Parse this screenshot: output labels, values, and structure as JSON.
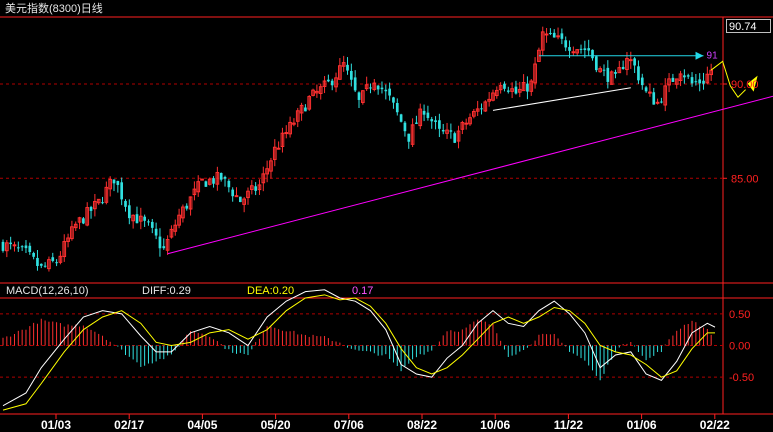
{
  "title": "美元指数(8300)日线",
  "last_price": "90.74",
  "indicator": {
    "name": "MACD(12,26,10)",
    "diff": "DIFF:0.29",
    "dea": "DEA:0.20",
    "macd": "0.17"
  },
  "colors": {
    "up": "#ff3030",
    "down": "#30e0e0",
    "trendline": "#ff00ff",
    "dea": "#ffff00",
    "diff": "#ffffff",
    "grid": "#b00000",
    "axis": "#ff2020"
  },
  "chart_data": [
    {
      "type": "candlestick",
      "title": "美元指数(8300)日线",
      "x_tick_labels": [
        "01/03",
        "02/17",
        "04/05",
        "05/20",
        "07/06",
        "08/22",
        "10/06",
        "11/22",
        "01/06",
        "02/22"
      ],
      "y_tick_labels": [
        "90.00",
        "85.00"
      ],
      "y_range": [
        79.5,
        93.5
      ],
      "grid": "dashed horizontal",
      "close_path": [
        [
          0,
          81.5
        ],
        [
          6,
          81.0
        ],
        [
          10,
          80.2
        ],
        [
          14,
          80.6
        ],
        [
          19,
          82.5
        ],
        [
          25,
          83.7
        ],
        [
          29,
          85.0
        ],
        [
          33,
          83.2
        ],
        [
          38,
          82.4
        ],
        [
          42,
          81.2
        ],
        [
          46,
          83.0
        ],
        [
          52,
          84.8
        ],
        [
          57,
          85.0
        ],
        [
          62,
          83.8
        ],
        [
          67,
          84.6
        ],
        [
          71,
          86.5
        ],
        [
          76,
          88.0
        ],
        [
          80,
          89.2
        ],
        [
          85,
          90.0
        ],
        [
          89,
          91.0
        ],
        [
          93,
          89.0
        ],
        [
          97,
          90.3
        ],
        [
          101,
          89.2
        ],
        [
          104,
          88.0
        ],
        [
          106,
          87.2
        ],
        [
          110,
          88.7
        ],
        [
          114,
          87.4
        ],
        [
          118,
          87.2
        ],
        [
          122,
          88.2
        ],
        [
          126,
          89.0
        ],
        [
          130,
          90.2
        ],
        [
          134,
          89.5
        ],
        [
          138,
          90.0
        ],
        [
          141,
          92.6
        ],
        [
          145,
          92.3
        ],
        [
          149,
          92.0
        ],
        [
          153,
          91.8
        ],
        [
          156,
          90.7
        ],
        [
          160,
          90.2
        ],
        [
          163,
          91.5
        ],
        [
          165,
          90.9
        ],
        [
          168,
          89.5
        ],
        [
          171,
          89.0
        ],
        [
          174,
          90.0
        ],
        [
          177,
          90.8
        ],
        [
          180,
          90.0
        ],
        [
          183,
          90.2
        ],
        [
          185,
          90.74
        ]
      ],
      "projection": [
        [
          185,
          90.74
        ],
        [
          188,
          91.2
        ],
        [
          190,
          89.9
        ],
        [
          192,
          89.3
        ],
        [
          194,
          89.7
        ]
      ],
      "trendlines": [
        {
          "color": "trendline",
          "from": [
            43,
            81.0
          ],
          "to": [
            204,
            89.5
          ]
        },
        {
          "color": "white",
          "from": [
            128,
            88.6
          ],
          "to": [
            164,
            89.8
          ]
        },
        {
          "color": "cyan",
          "from": [
            140,
            91.5
          ],
          "to": [
            183,
            91.5
          ],
          "label": "91"
        }
      ]
    },
    {
      "type": "macd",
      "title": "MACD(12,26,10)",
      "values": {
        "DIFF": 0.29,
        "DEA": 0.2,
        "MACD": 0.17
      },
      "y_tick_labels": [
        "0.50",
        "0.00",
        "-0.50"
      ],
      "y_range": [
        -1.05,
        0.75
      ],
      "diff_path": [
        [
          0,
          -0.95
        ],
        [
          6,
          -0.75
        ],
        [
          10,
          -0.35
        ],
        [
          16,
          0.1
        ],
        [
          21,
          0.45
        ],
        [
          26,
          0.55
        ],
        [
          31,
          0.5
        ],
        [
          36,
          0.15
        ],
        [
          40,
          -0.1
        ],
        [
          44,
          -0.1
        ],
        [
          49,
          0.2
        ],
        [
          54,
          0.3
        ],
        [
          59,
          0.2
        ],
        [
          64,
          0.0
        ],
        [
          69,
          0.45
        ],
        [
          74,
          0.7
        ],
        [
          79,
          0.85
        ],
        [
          84,
          0.88
        ],
        [
          88,
          0.75
        ],
        [
          92,
          0.7
        ],
        [
          96,
          0.55
        ],
        [
          100,
          0.25
        ],
        [
          104,
          -0.3
        ],
        [
          108,
          -0.45
        ],
        [
          112,
          -0.5
        ],
        [
          116,
          -0.2
        ],
        [
          120,
          0.0
        ],
        [
          124,
          0.35
        ],
        [
          128,
          0.55
        ],
        [
          132,
          0.35
        ],
        [
          136,
          0.3
        ],
        [
          140,
          0.55
        ],
        [
          144,
          0.7
        ],
        [
          148,
          0.5
        ],
        [
          152,
          0.2
        ],
        [
          156,
          -0.35
        ],
        [
          160,
          -0.15
        ],
        [
          164,
          -0.1
        ],
        [
          168,
          -0.45
        ],
        [
          172,
          -0.55
        ],
        [
          176,
          -0.25
        ],
        [
          180,
          0.2
        ],
        [
          184,
          0.35
        ],
        [
          186,
          0.29
        ]
      ],
      "dea_path": [
        [
          0,
          -1.02
        ],
        [
          6,
          -0.92
        ],
        [
          10,
          -0.6
        ],
        [
          16,
          -0.1
        ],
        [
          21,
          0.25
        ],
        [
          26,
          0.45
        ],
        [
          31,
          0.55
        ],
        [
          36,
          0.35
        ],
        [
          40,
          0.05
        ],
        [
          44,
          0.0
        ],
        [
          49,
          0.05
        ],
        [
          54,
          0.2
        ],
        [
          59,
          0.25
        ],
        [
          64,
          0.1
        ],
        [
          69,
          0.25
        ],
        [
          74,
          0.55
        ],
        [
          79,
          0.75
        ],
        [
          84,
          0.8
        ],
        [
          88,
          0.72
        ],
        [
          92,
          0.75
        ],
        [
          96,
          0.62
        ],
        [
          100,
          0.35
        ],
        [
          104,
          -0.05
        ],
        [
          108,
          -0.35
        ],
        [
          112,
          -0.45
        ],
        [
          116,
          -0.35
        ],
        [
          120,
          -0.15
        ],
        [
          124,
          0.1
        ],
        [
          128,
          0.35
        ],
        [
          132,
          0.45
        ],
        [
          136,
          0.35
        ],
        [
          140,
          0.45
        ],
        [
          144,
          0.6
        ],
        [
          148,
          0.55
        ],
        [
          152,
          0.35
        ],
        [
          156,
          0.0
        ],
        [
          160,
          -0.1
        ],
        [
          164,
          -0.15
        ],
        [
          168,
          -0.3
        ],
        [
          172,
          -0.5
        ],
        [
          176,
          -0.4
        ],
        [
          180,
          -0.05
        ],
        [
          184,
          0.2
        ],
        [
          186,
          0.2
        ]
      ]
    }
  ]
}
